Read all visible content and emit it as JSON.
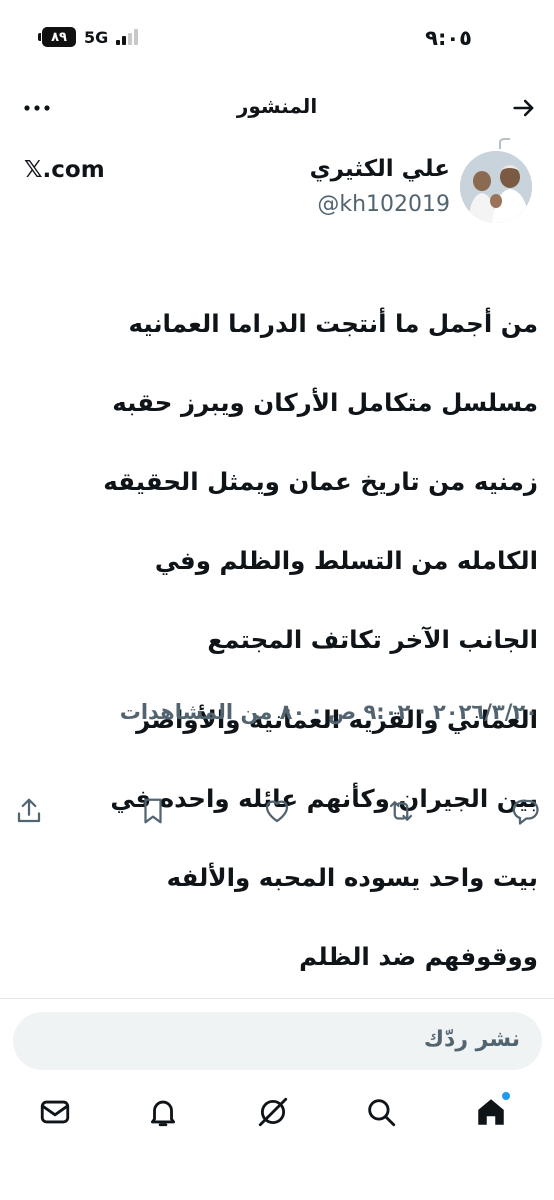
{
  "status_bar": {
    "time": "٩:٠٥",
    "battery": "٨٩",
    "network": "5G"
  },
  "header": {
    "title": "المنشور",
    "back_icon": "arrow-right-icon",
    "more_icon": "more-horizontal-icon"
  },
  "post": {
    "author_name": "علي الكثيري",
    "author_handle": "@kh102019",
    "source": "𝕏.com",
    "lines": [
      "من أجمل ما أنتجت الدراما العمانيه",
      "مسلسل متكامل الأركان ويبرز حقبه",
      "زمنيه من تاريخ عمان ويمثل الحقيقه",
      "الكامله من التسلط والظلم وفي",
      "الجانب الآخر تكاتف المجتمع",
      "العماني والقريه العمانية والأواصر",
      "بين الجيران وكأنهم عائله واحده في",
      "بيت واحد يسوده المحبه والألفه",
      "ووقوفهم ضد الظلم"
    ],
    "meta": "٢٠٢٦/٣/٢٠ · ٩:٠٢ ص · ٨٠ من المشاهدات"
  },
  "actions": [
    {
      "name": "reply-icon"
    },
    {
      "name": "repost-icon"
    },
    {
      "name": "like-icon"
    },
    {
      "name": "bookmark-icon"
    },
    {
      "name": "share-icon"
    }
  ],
  "reply_bar": {
    "placeholder": "نشر ردّك"
  },
  "bottom_nav": [
    {
      "name": "home-icon",
      "active": true
    },
    {
      "name": "search-icon"
    },
    {
      "name": "grok-icon"
    },
    {
      "name": "notifications-icon"
    },
    {
      "name": "messages-icon"
    }
  ],
  "colors": {
    "text": "#0f1419",
    "muted": "#536471",
    "accent": "#1d9bf0",
    "input_bg": "#eff3f4"
  }
}
